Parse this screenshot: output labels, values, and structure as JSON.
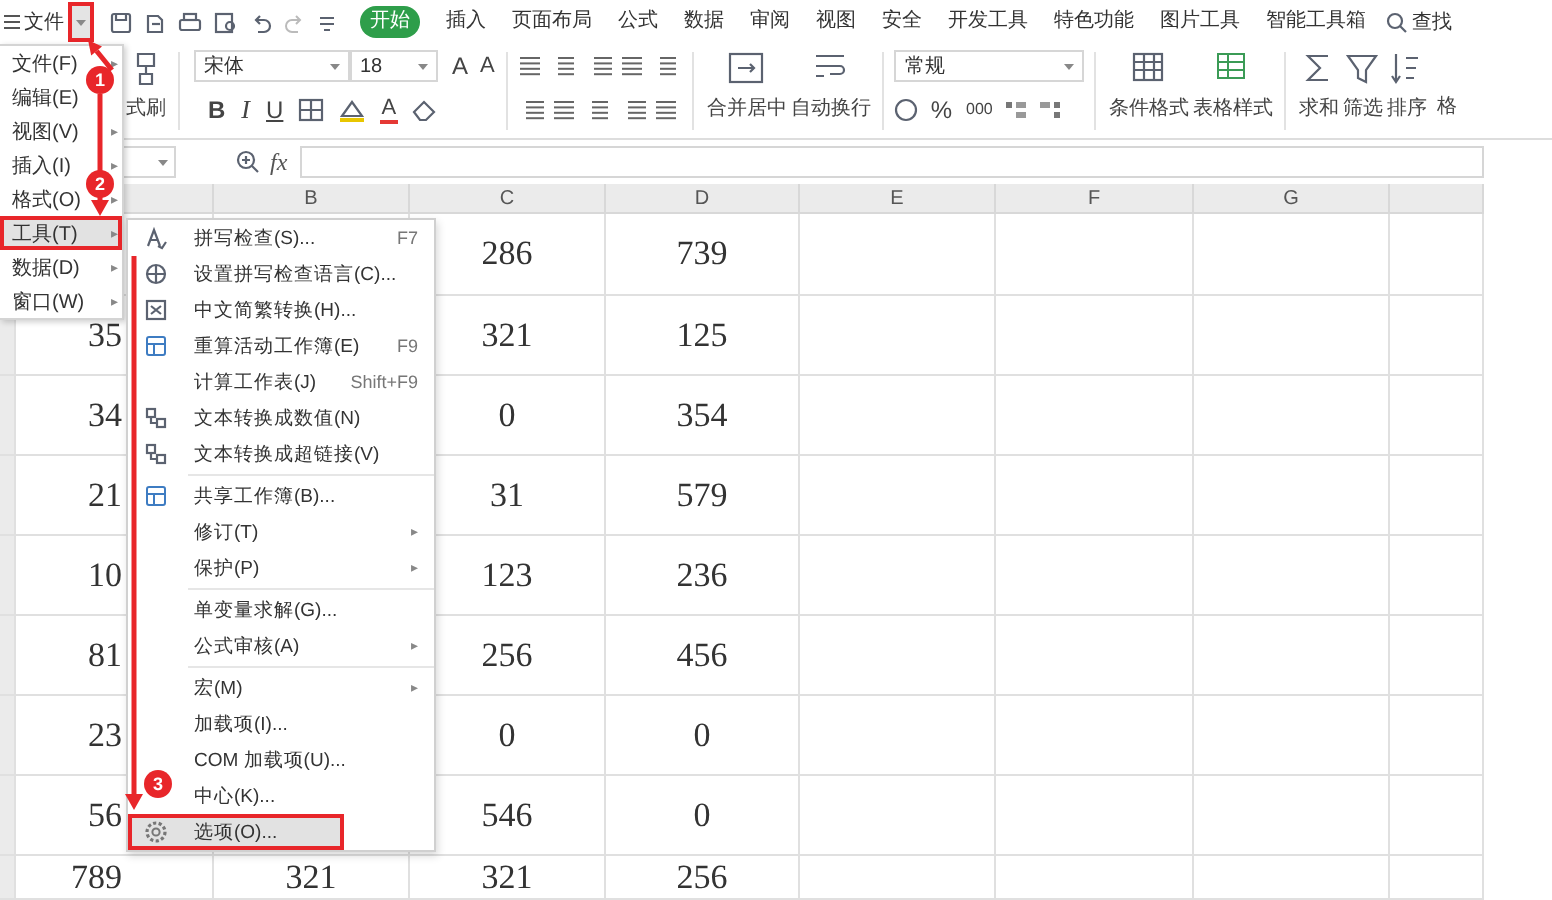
{
  "menu_bar": {
    "app_menu": "文件"
  },
  "quick_access": {
    "dropdown_boxed": true
  },
  "tabs": [
    {
      "label": "开始",
      "selected": true
    },
    {
      "label": "插入",
      "selected": false
    },
    {
      "label": "页面布局",
      "selected": false
    },
    {
      "label": "公式",
      "selected": false
    },
    {
      "label": "数据",
      "selected": false
    },
    {
      "label": "审阅",
      "selected": false
    },
    {
      "label": "视图",
      "selected": false
    },
    {
      "label": "安全",
      "selected": false
    },
    {
      "label": "开发工具",
      "selected": false
    },
    {
      "label": "特色功能",
      "selected": false
    },
    {
      "label": "图片工具",
      "selected": false
    },
    {
      "label": "智能工具箱",
      "selected": false
    }
  ],
  "search": {
    "label": "查找"
  },
  "ribbon": {
    "format_painter": "式刷",
    "font": "宋体",
    "font_size": "18",
    "grow_font": "A",
    "shrink_font": "A",
    "bold": "B",
    "italic": "I",
    "underline": "U",
    "font_color": "A",
    "merge": "合并居中",
    "wrap": "自动换行",
    "number_format": "常规",
    "percent": "%",
    "thousands": "000",
    "conditional_format": "条件格式",
    "table_style": "表格样式",
    "sum": "求和",
    "filter": "筛选",
    "sort": "排序",
    "cut_off": "格"
  },
  "formula_bar": {
    "fx": "fx"
  },
  "sheet": {
    "column_headers": [
      "B",
      "C",
      "D",
      "E",
      "F",
      "G"
    ],
    "rows": [
      {
        "C": "286",
        "D": "739"
      },
      {
        "A": "35",
        "C": "321",
        "D": "125"
      },
      {
        "A": "34",
        "C": "0",
        "D": "354"
      },
      {
        "A": "21",
        "C": "31",
        "D": "579"
      },
      {
        "A": "10",
        "C": "123",
        "D": "236"
      },
      {
        "A": "81",
        "C": "256",
        "D": "456"
      },
      {
        "A": "23",
        "C": "0",
        "D": "0"
      },
      {
        "A": "56",
        "C": "546",
        "D": "0"
      },
      {
        "A": "789",
        "B": "321",
        "C": "321",
        "D": "256"
      }
    ]
  },
  "file_menu": {
    "items": [
      {
        "label": "文件(F)",
        "arrow": "▸",
        "selected": false,
        "boxed": false
      },
      {
        "label": "编辑(E)",
        "selected": false,
        "boxed": false
      },
      {
        "label": "视图(V)",
        "arrow": "▸",
        "selected": false,
        "boxed": false
      },
      {
        "label": "插入(I)",
        "arrow": "▸",
        "selected": false,
        "boxed": false
      },
      {
        "label": "格式(O)",
        "arrow": "▸",
        "selected": false,
        "boxed": false
      },
      {
        "label": "工具(T)",
        "arrow": "▸",
        "selected": true,
        "boxed": true
      },
      {
        "label": "数据(D)",
        "arrow": "▸",
        "selected": false,
        "boxed": false
      },
      {
        "label": "窗口(W)",
        "arrow": "▸",
        "selected": false,
        "boxed": false
      }
    ]
  },
  "tools_menu": {
    "groups": [
      {
        "items": [
          {
            "label": "拼写检查(S)...",
            "shortcut": "F7",
            "kind": "spell",
            "selected": false,
            "boxed": false
          },
          {
            "label": "设置拼写检查语言(C)...",
            "kind": "globe",
            "selected": false,
            "boxed": false
          },
          {
            "label": "中文简繁转换(H)...",
            "kind": "convert",
            "selected": false,
            "boxed": false
          },
          {
            "label": "重算活动工作簿(E)",
            "shortcut": "F9",
            "kind": "sheet",
            "selected": false,
            "boxed": false
          },
          {
            "label": "计算工作表(J)",
            "shortcut": "Shift+F9",
            "selected": false,
            "boxed": false
          },
          {
            "label": "文本转换成数值(N)",
            "kind": "grid",
            "selected": false,
            "boxed": false
          },
          {
            "label": "文本转换成超链接(V)",
            "kind": "grid",
            "selected": false,
            "boxed": false
          }
        ]
      },
      {
        "items": [
          {
            "label": "共享工作簿(B)...",
            "kind": "sheet",
            "selected": false,
            "boxed": false
          },
          {
            "label": "修订(T)",
            "arrow": "▸",
            "selected": false,
            "boxed": false
          },
          {
            "label": "保护(P)",
            "arrow": "▸",
            "selected": false,
            "boxed": false
          }
        ]
      },
      {
        "items": [
          {
            "label": "单变量求解(G)...",
            "selected": false,
            "boxed": false
          },
          {
            "label": "公式审核(A)",
            "arrow": "▸",
            "selected": false,
            "boxed": false
          }
        ]
      },
      {
        "items": [
          {
            "label": "宏(M)",
            "arrow": "▸",
            "selected": false,
            "boxed": false
          },
          {
            "label": "加载项(I)...",
            "selected": false,
            "boxed": false
          },
          {
            "label": "COM 加载项(U)...",
            "selected": false,
            "boxed": false
          },
          {
            "label": "中心(K)...",
            "selected": false,
            "boxed": false
          },
          {
            "label": "选项(O)...",
            "kind": "gear",
            "selected": true,
            "boxed": true
          }
        ]
      }
    ]
  },
  "annotations": [
    {
      "label": "1"
    },
    {
      "label": "2"
    },
    {
      "label": "3"
    }
  ]
}
